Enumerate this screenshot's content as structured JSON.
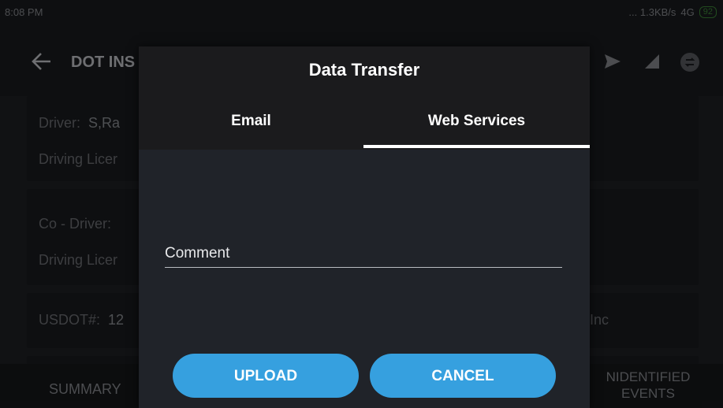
{
  "status_bar": {
    "time": "8:08 PM",
    "network": "... 1.3KB/s",
    "signal_text": "4G",
    "battery": "92"
  },
  "app_bar": {
    "title": "DOT INS"
  },
  "background_content": {
    "driver_label": "Driver:",
    "driver_value": "S,Ra",
    "driving_license_1": "Driving Licer",
    "co_driver_label": "Co - Driver:",
    "driving_license_2": "Driving Licer",
    "usdot_label": "USDOT#:",
    "usdot_value": "12",
    "carrier_suffix": "Inc"
  },
  "bottom_tabs": {
    "summary": "SUMMARY",
    "unidentified_line1": "NIDENTIFIED",
    "unidentified_line2": "EVENTS"
  },
  "dialog": {
    "title": "Data Transfer",
    "tabs": [
      {
        "label": "Email",
        "selected": false
      },
      {
        "label": "Web Services",
        "selected": true
      }
    ],
    "comment_placeholder": "Comment",
    "upload_label": "UPLOAD",
    "cancel_label": "CANCEL"
  },
  "colors": {
    "button": "#36a0df",
    "dialog_bg": "#202329",
    "header_bg": "#1b1b1d"
  },
  "icons": [
    "back-arrow-icon",
    "send-icon",
    "signal-icon",
    "sync-icon"
  ]
}
